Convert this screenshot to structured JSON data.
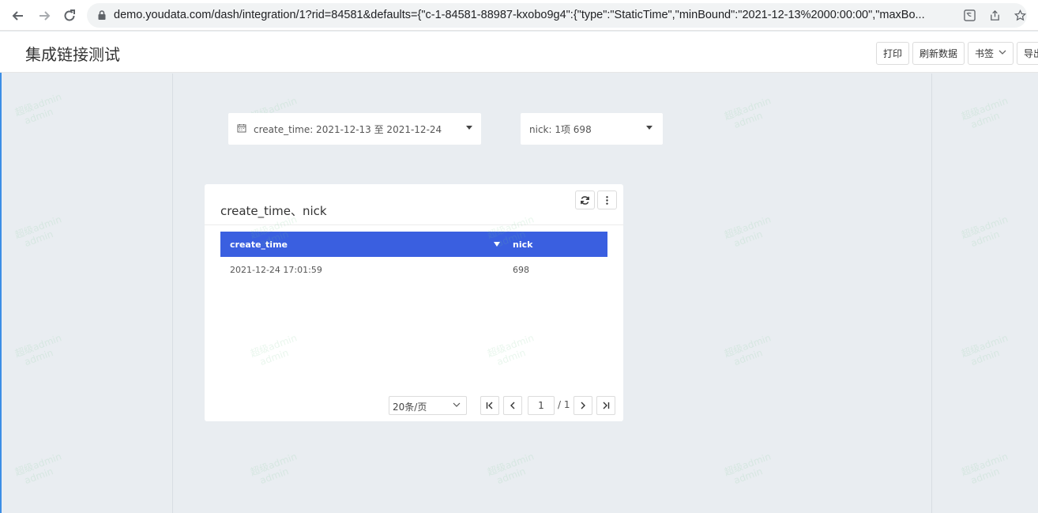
{
  "browser": {
    "url": "demo.youdata.com/dash/integration/1?rid=84581&defaults={\"c-1-84581-88987-kxobo9g4\":{\"type\":\"StaticTime\",\"minBound\":\"2021-12-13%2000:00:00\",\"maxBo..."
  },
  "header": {
    "title": "集成链接测试",
    "print_label": "打印",
    "refresh_label": "刷新数据",
    "bookmark_label": "书签",
    "export_label": "导出"
  },
  "filters": {
    "time_filter": "create_time: 2021-12-13 至 2021-12-24",
    "nick_filter": "nick: 1项 698"
  },
  "widget": {
    "title": "create_time、nick",
    "columns": [
      "create_time",
      "nick"
    ],
    "rows": [
      [
        "2021-12-24 17:01:59",
        "698"
      ]
    ],
    "page_size": "20条/页",
    "current_page": "1",
    "total_pages": "/ 1"
  },
  "watermark": {
    "line1": "超级admin",
    "line2": "admin"
  },
  "colors": {
    "table_header": "#3a5fe0",
    "canvas_bg": "#e9edf1",
    "accent_edge": "#3c8ee6"
  }
}
